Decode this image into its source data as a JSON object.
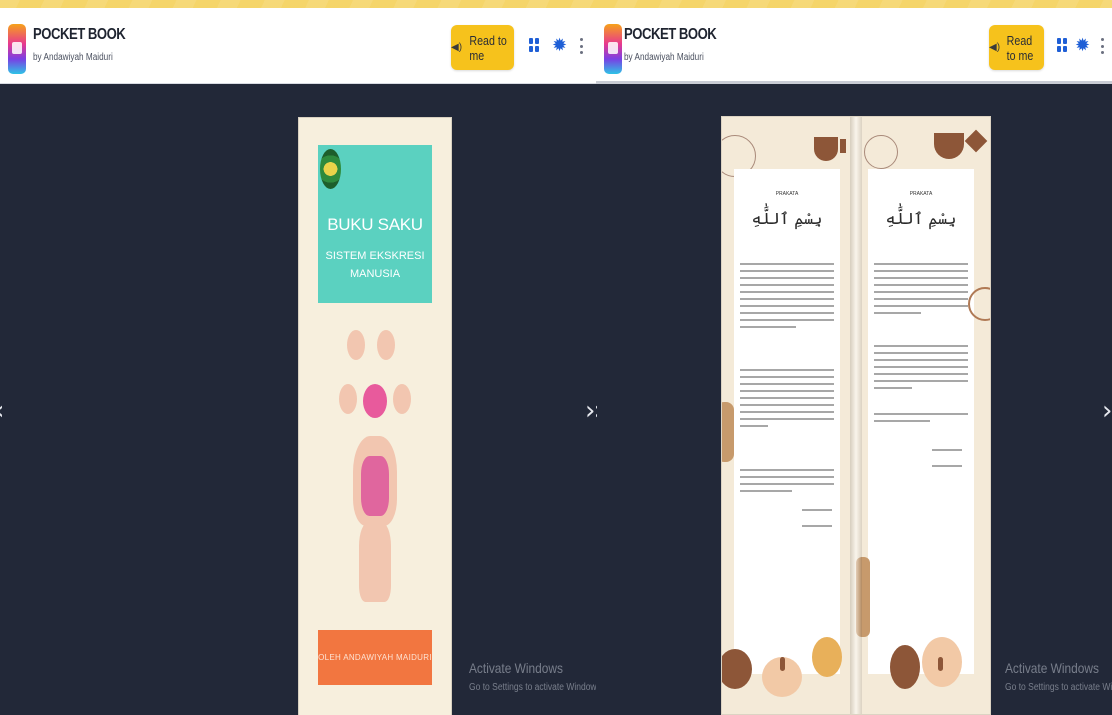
{
  "app": {
    "title": "POCKET BOOK",
    "author": "by Andawiyah Maiduri",
    "read_label": "Read to me"
  },
  "right_app": {
    "title": "POCKET BOOK",
    "author": "by Andawiyah Maiduri",
    "read_label": "Read to me"
  },
  "cover": {
    "title": "BUKU SAKU",
    "subtitle": "SISTEM EKSKRESI MANUSIA",
    "footer": "OLEH ANDAWIYAH MAIDURI"
  },
  "book": {
    "left_heading": "PRAKATA",
    "right_heading": "PRAKATA",
    "bismillah": "بِسْمِ ٱللَّٰهِ"
  },
  "nav": {
    "prev_glyph": "‹",
    "next_glyph": "›"
  },
  "watermark": {
    "line1": "Activate Windows",
    "line2": "Go to Settings to activate Windows."
  },
  "icons": [
    "app-logo-icon",
    "speaker-icon",
    "grid-icon",
    "gear-icon",
    "kebab-menu-icon",
    "chevron-left-icon",
    "chevron-right-icon"
  ],
  "colors": {
    "accent": "#f6c21c",
    "reader_bg": "#222838",
    "cover_teal": "#5bd1c0",
    "cover_orange": "#f27640",
    "icon_blue": "#1f5fd6"
  }
}
